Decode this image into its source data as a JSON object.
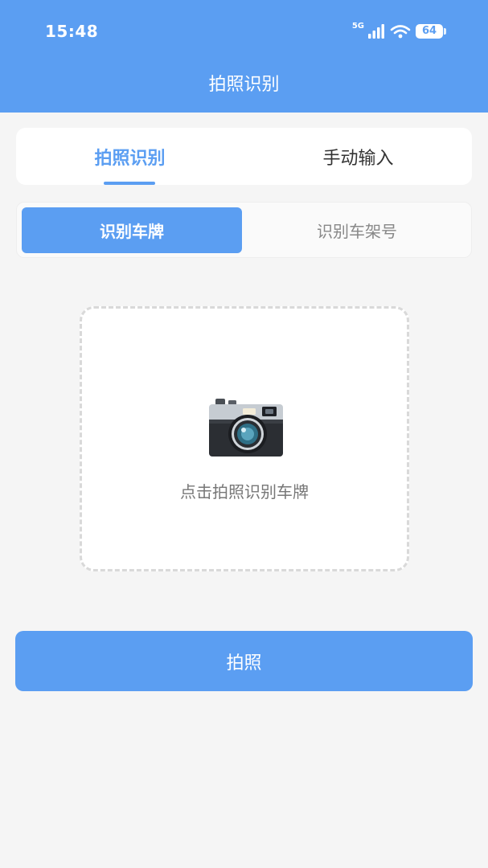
{
  "status_bar": {
    "time": "15:48",
    "network": "5G",
    "battery": "64",
    "icons": [
      "signal-icon",
      "wifi-icon",
      "battery-icon"
    ]
  },
  "header": {
    "title": "拍照识别"
  },
  "tabs": [
    {
      "label": "拍照识别",
      "active": true
    },
    {
      "label": "手动输入",
      "active": false
    }
  ],
  "segments": [
    {
      "label": "识别车牌",
      "active": true
    },
    {
      "label": "识别车架号",
      "active": false
    }
  ],
  "capture": {
    "hint": "点击拍照识别车牌",
    "icon": "camera-icon"
  },
  "actions": {
    "shoot_label": "拍照"
  },
  "colors": {
    "primary": "#5b9ef2",
    "background": "#f5f5f5",
    "text_dark": "#333333",
    "text_muted": "#888888"
  }
}
